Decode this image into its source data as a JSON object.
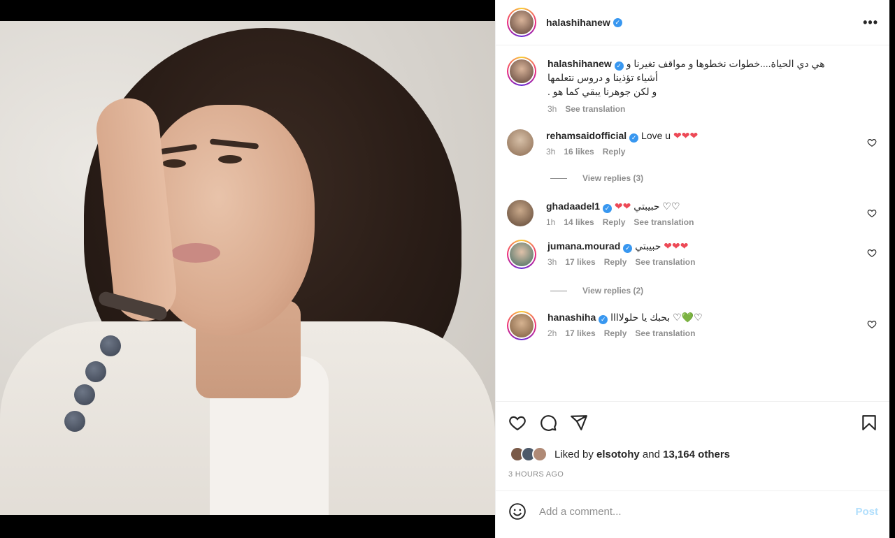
{
  "post": {
    "author": "halashihanew",
    "caption_lines": [
      "هي دي الحياة....خطوات نخطوها و مواقف تغيرنا و",
      "أشياء تؤذينا و دروس نتعلمها",
      "و لكن جوهرنا يبقي كما هو ."
    ],
    "caption_time": "3h",
    "caption_translate": "See translation",
    "liked_by_prefix": "Liked by",
    "liked_by_user": "elsotohy",
    "liked_by_and": "and",
    "liked_by_others": "13,164 others",
    "time_ago": "3 HOURS AGO"
  },
  "comments": [
    {
      "user": "rehamsaidofficial",
      "text": "Love u",
      "hearts": "❤❤❤",
      "time": "3h",
      "likes": "16 likes",
      "reply": "Reply",
      "translate": "",
      "replies": "View replies (3)",
      "avatar_color": "#b89a80"
    },
    {
      "user": "ghadaadel1",
      "text": "حبيبتي ♡♡",
      "hearts": "❤❤",
      "time": "1h",
      "likes": "14 likes",
      "reply": "Reply",
      "translate": "See translation",
      "replies": "",
      "avatar_color": "#8a6b4f"
    },
    {
      "user": "jumana.mourad",
      "text": "حبيبتي",
      "hearts": "❤❤❤",
      "time": "3h",
      "likes": "17 likes",
      "reply": "Reply",
      "translate": "See translation",
      "replies": "View replies (2)",
      "avatar_color": "#5a8b7a"
    },
    {
      "user": "hanashiha",
      "text": "بحبك يا حلولاااا",
      "hearts": "♡💚♡",
      "time": "2h",
      "likes": "17 likes",
      "reply": "Reply",
      "translate": "See translation",
      "replies": "",
      "avatar_color": "#a08060"
    }
  ],
  "add_comment": {
    "placeholder": "Add a comment...",
    "post_label": "Post"
  },
  "colors": {
    "accent": "#3897f0",
    "heart": "#ed4956",
    "muted": "#8e8e8e"
  },
  "icons": [
    "more-icon",
    "heart-icon",
    "comment-icon",
    "share-icon",
    "bookmark-icon",
    "emoji-icon",
    "verified-icon"
  ]
}
